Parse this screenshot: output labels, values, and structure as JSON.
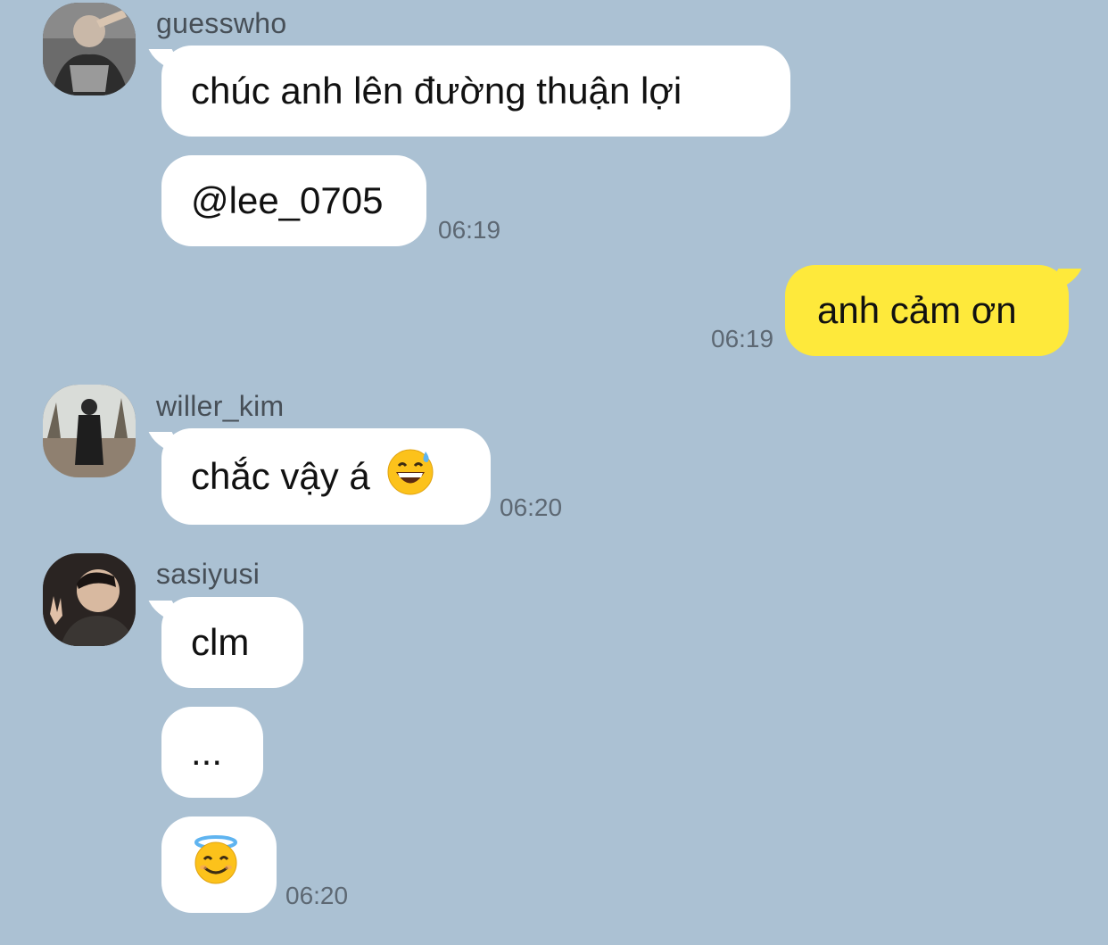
{
  "messages": [
    {
      "sender": "guesswho",
      "avatar": "avatar-guesswho",
      "bubbles": [
        "chúc anh lên đường thuận lợi",
        "@lee_0705"
      ],
      "time": "06:19"
    },
    {
      "sender": "me",
      "bubbles": [
        "anh cảm ơn"
      ],
      "time": "06:19"
    },
    {
      "sender": "willer_kim",
      "avatar": "avatar-willer-kim",
      "bubbles": [
        "chắc vậy á"
      ],
      "bubble_emoji": "grinning-face-with-sweat",
      "time": "06:20"
    },
    {
      "sender": "sasiyusi",
      "avatar": "avatar-sasiyusi",
      "bubbles": [
        "clm",
        "..."
      ],
      "last_bubble_emoji": "smiling-face-with-halo",
      "time": "06:20"
    }
  ],
  "colors": {
    "background": "#abc1d3",
    "incoming_bubble": "#ffffff",
    "outgoing_bubble": "#fee93b"
  }
}
